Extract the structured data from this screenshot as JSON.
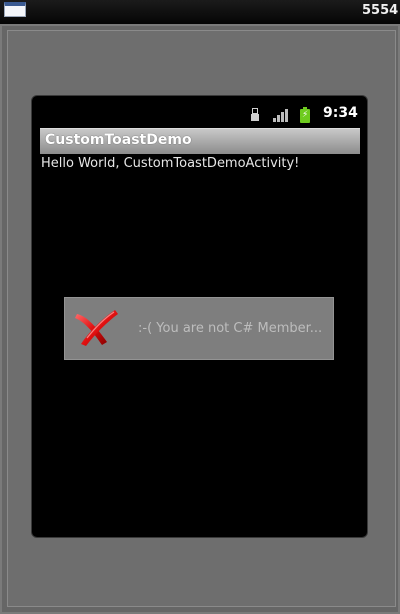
{
  "window": {
    "title": "5554",
    "icon": "window-icon"
  },
  "status_bar": {
    "time": "9:34",
    "icons": [
      "usb-icon",
      "signal-icon",
      "battery-charging-icon"
    ],
    "battery_color": "#6ecb1f"
  },
  "app": {
    "title": "CustomToastDemo",
    "body_text": "Hello World, CustomToastDemoActivity!"
  },
  "toast": {
    "icon": "red-x-icon",
    "message": ":-( You are not C# Member..."
  }
}
